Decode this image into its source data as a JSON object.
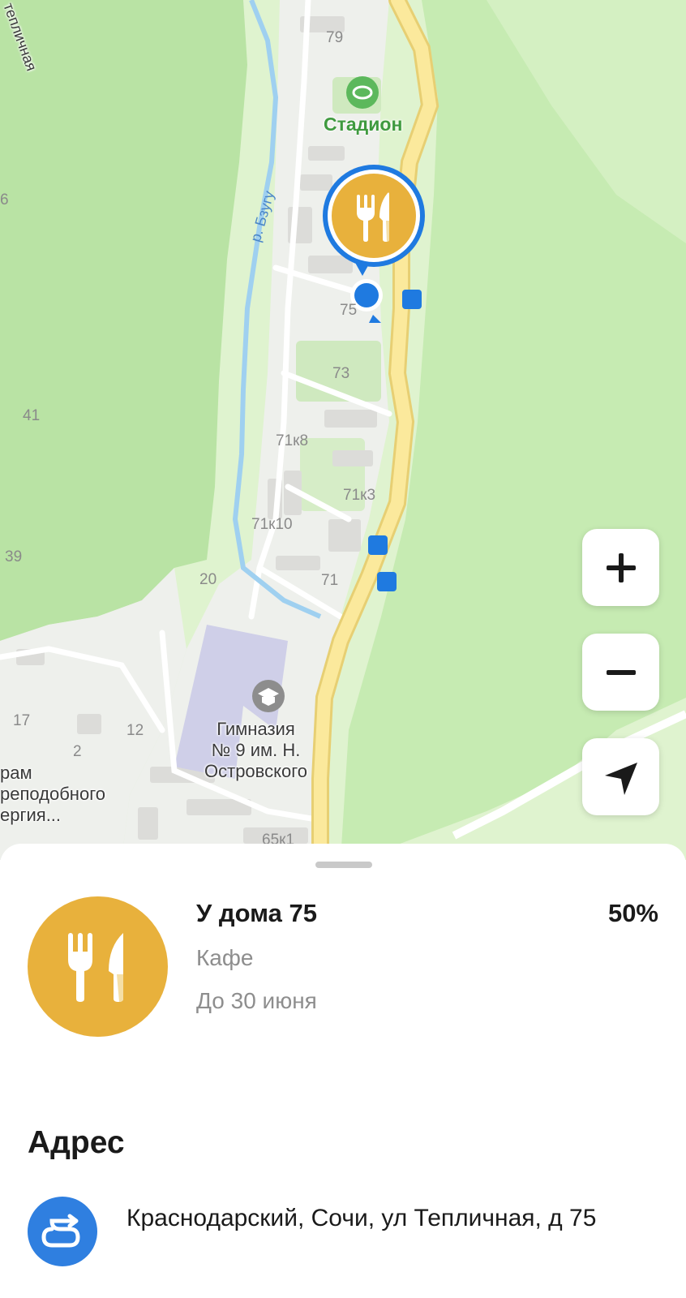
{
  "map": {
    "labels": {
      "stadium": "Стадион",
      "river": "р. Бзугу",
      "street_partial": "тепличная",
      "gymnasium": "Гимназия\n№ 9 им. Н.\nОстровского",
      "temple": "рам\nреподобного\nергия..."
    },
    "house_numbers": [
      "79",
      "75",
      "73",
      "71к8",
      "71к3",
      "71к10",
      "71",
      "41",
      "39",
      "20",
      "17",
      "12",
      "2",
      "65к1",
      "6"
    ],
    "icons": {
      "poi_marker": "cafe-fork-knife-icon",
      "stadium": "stadium-icon",
      "gymnasium": "graduation-cap-icon",
      "bus_stop": "bus-stop-icon",
      "user_location": "user-location-dot"
    },
    "controls": {
      "zoom_in": "+",
      "zoom_out": "−",
      "locate_icon": "navigation-arrow-icon"
    }
  },
  "place": {
    "title": "У дома 75",
    "category": "Кафе",
    "valid_until": "До 30 июня",
    "discount": "50%",
    "icon": "fork-knife-icon",
    "icon_color": "#E8B13C"
  },
  "address": {
    "section_title": "Адрес",
    "text": "Краснодарский, Сочи, ул Тепличная, д 75",
    "icon": "route-icon",
    "icon_color": "#2F7FE0"
  }
}
